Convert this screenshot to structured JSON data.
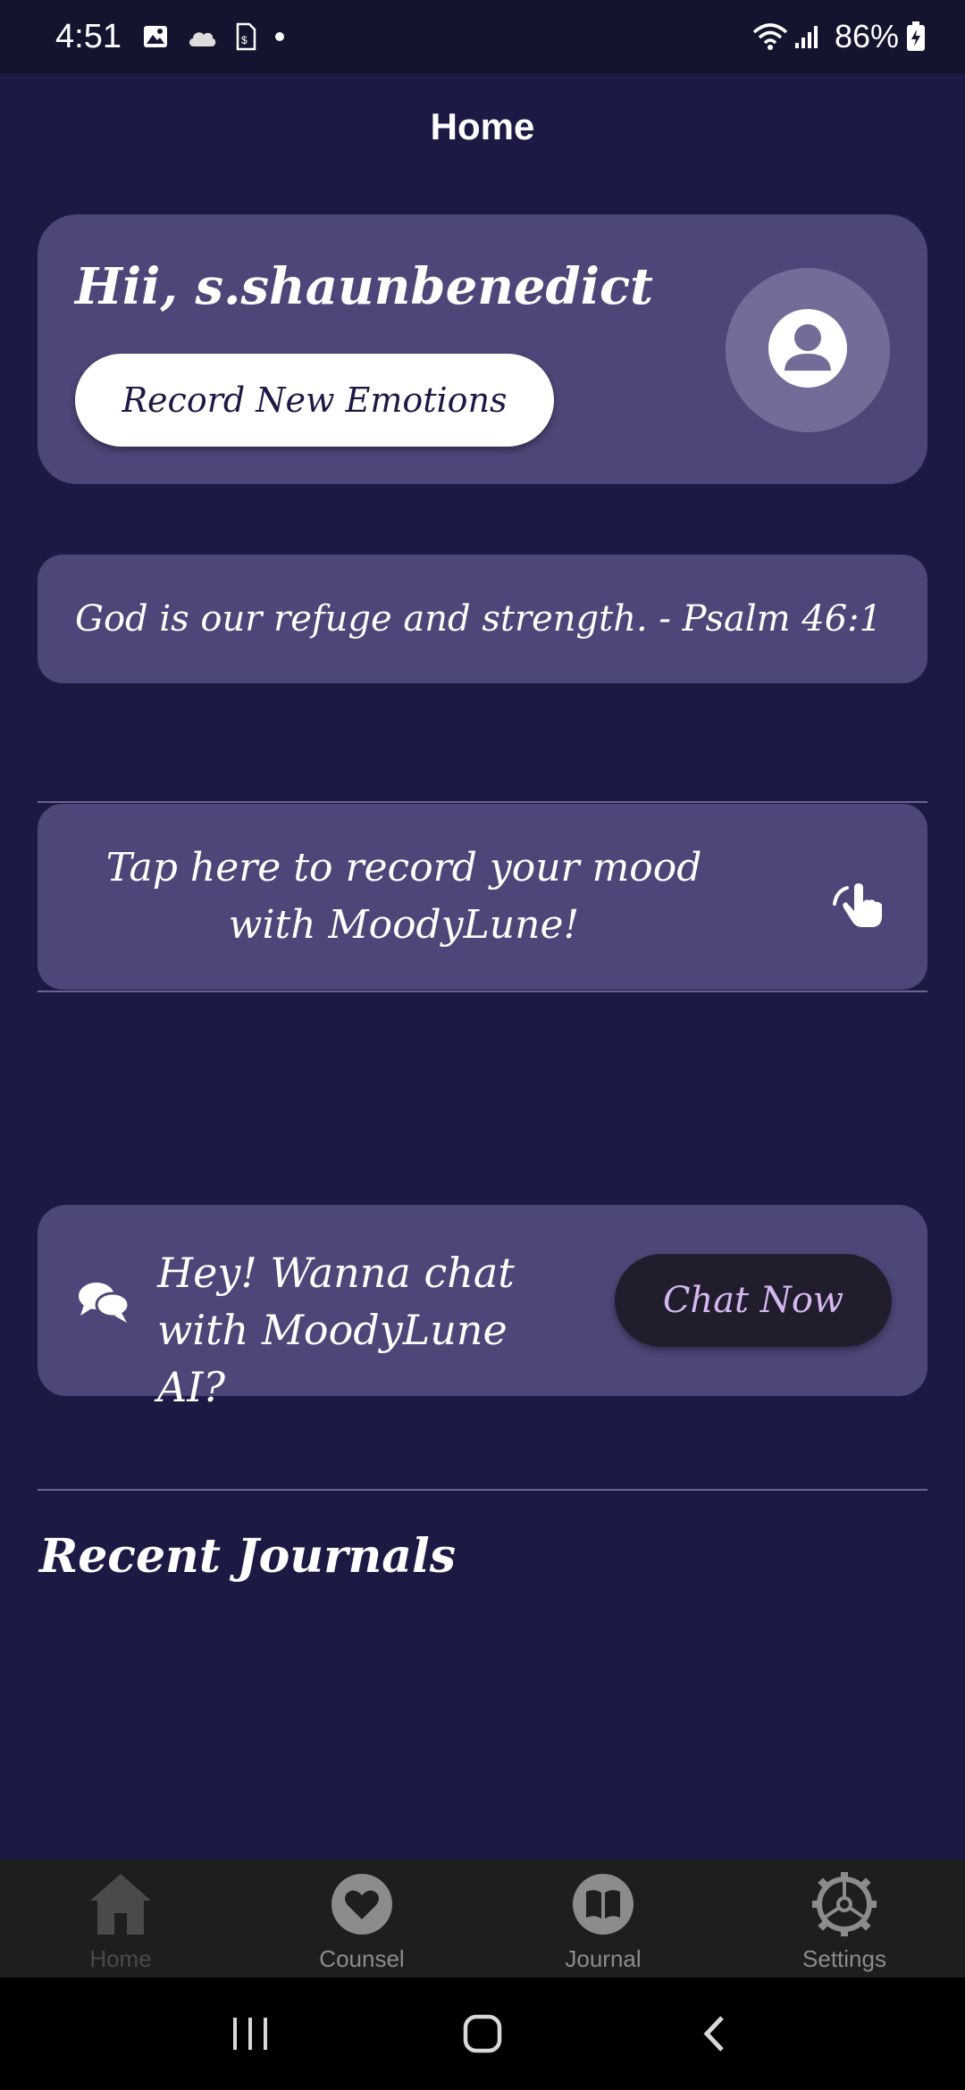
{
  "status_bar": {
    "time": "4:51",
    "battery": "86%",
    "icons": [
      "gallery-icon",
      "cloud-icon",
      "sim-icon",
      "dot-icon",
      "wifi-icon",
      "signal-icon",
      "battery-icon"
    ]
  },
  "app_bar": {
    "title": "Home"
  },
  "greeting_card": {
    "greeting": "Hii, s.shaunbenedict",
    "record_button_label": "Record New Emotions",
    "avatar_icon": "person-icon"
  },
  "quote_card": {
    "quote": "God is our refuge and strength. - Psalm 46:1"
  },
  "mood_card": {
    "text": "Tap here to record your mood with MoodyLune!",
    "icon": "tap-hand-icon"
  },
  "chat_card": {
    "text": "Hey! Wanna chat with MoodyLune AI?",
    "button_label": "Chat Now",
    "icon": "chat-bubbles-icon"
  },
  "recent_journals": {
    "title": "Recent Journals"
  },
  "bottom_nav": {
    "items": [
      {
        "label": "Home",
        "icon": "home-icon",
        "active": true
      },
      {
        "label": "Counsel",
        "icon": "heart-icon",
        "active": false
      },
      {
        "label": "Journal",
        "icon": "book-icon",
        "active": false
      },
      {
        "label": "Settings",
        "icon": "settings-icon",
        "active": false
      }
    ]
  },
  "colors": {
    "background": "#1c1a45",
    "card": "#4d4678",
    "accent_text": "#d5b7f0",
    "nav_background": "#1e1e1e"
  }
}
